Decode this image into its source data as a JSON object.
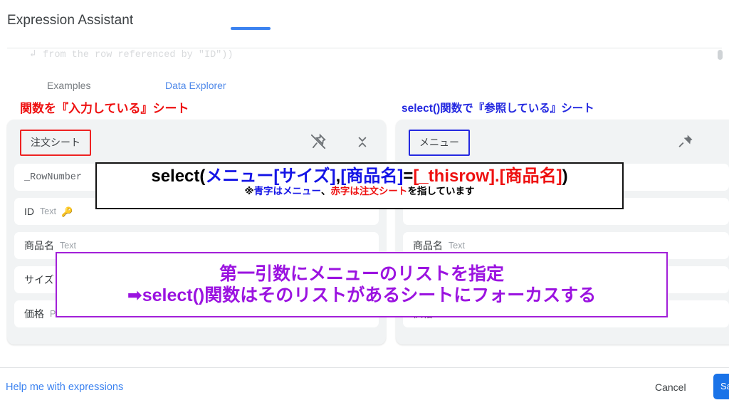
{
  "dialog": {
    "title": "Expression Assistant",
    "clipped_code_line": "from the row referenced by \"ID\"))",
    "clipped_code_glyph": "↲"
  },
  "tabs": [
    {
      "label": "Examples",
      "active": false
    },
    {
      "label": "Data Explorer",
      "active": true
    }
  ],
  "annotations": {
    "left_sheet_label": "関数を『入力している』シート",
    "right_sheet_label": "select()関数で『参照している』シート",
    "formula": {
      "p1": "select(",
      "p2": "メニュー[サイズ]",
      "p3": ",",
      "p4": "[商品名]",
      "p5": "=",
      "p6": "[_thisrow].[商品名]",
      "p7": ")",
      "note_1": "※",
      "note_2": "青字はメニュー",
      "note_3": "、",
      "note_4": "赤字は注文シート",
      "note_5": "を指しています"
    },
    "purple_box": {
      "line1": "第一引数にメニューのリストを指定",
      "line2": "➡select()関数はそのリストがあるシートにフォーカスする"
    }
  },
  "panels": {
    "left": {
      "sheet_name": "注文シート",
      "unpin_icon": "unpin-icon",
      "collapse_icon": "collapse-icon",
      "fields": [
        {
          "name": "_RowNumber",
          "type": "",
          "key": false,
          "mono": true
        },
        {
          "name": "ID",
          "type": "Text",
          "key": true,
          "mono": false
        },
        {
          "name": "商品名",
          "type": "Text",
          "key": false,
          "mono": false
        },
        {
          "name": "サイズ",
          "type": "",
          "key": false,
          "mono": false
        },
        {
          "name": "価格",
          "type": "Price",
          "key": false,
          "mono": false
        }
      ]
    },
    "right": {
      "sheet_name": "メニュー",
      "pin_icon": "pin-icon",
      "fields": [
        {
          "name": "",
          "type": "",
          "key": false,
          "mono": false
        },
        {
          "name": "",
          "type": "",
          "key": false,
          "mono": false
        },
        {
          "name": "商品名",
          "type": "Text",
          "key": false,
          "mono": false
        },
        {
          "name": "",
          "type": "",
          "key": false,
          "mono": false
        },
        {
          "name": "価格",
          "type": "Price",
          "key": false,
          "mono": false
        }
      ]
    }
  },
  "footer": {
    "help_link": "Help me with expressions",
    "cancel_label": "Cancel",
    "save_label": "Save"
  },
  "colors": {
    "accent_blue": "#3b82f0",
    "annotation_red": "#ee1111",
    "annotation_blue": "#2429e0",
    "annotation_purple": "#9B13E0",
    "panel_bg": "#f1f3f4"
  }
}
